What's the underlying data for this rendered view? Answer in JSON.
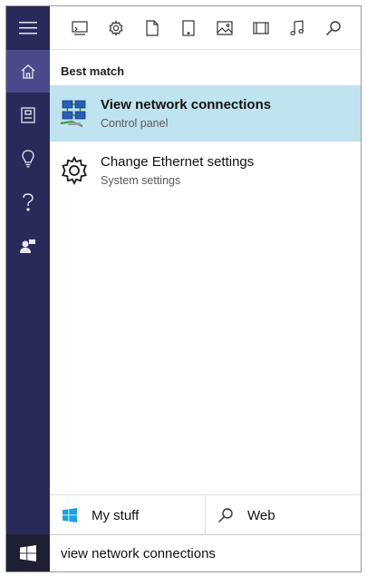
{
  "rail": {
    "items": [
      {
        "name": "hamburger-menu-icon",
        "active": false
      },
      {
        "name": "home-icon",
        "active": true
      },
      {
        "name": "notebook-icon",
        "active": false
      },
      {
        "name": "lightbulb-icon",
        "active": false
      },
      {
        "name": "help-icon",
        "active": false
      },
      {
        "name": "feedback-icon",
        "active": false
      }
    ]
  },
  "toolbar": {
    "filters": [
      "apps-icon",
      "settings-icon",
      "documents-icon",
      "tablet-icon",
      "photos-icon",
      "videos-icon",
      "music-icon",
      "search-icon"
    ]
  },
  "results": {
    "section_title": "Best match",
    "items": [
      {
        "title": "View network connections",
        "subtitle": "Control panel",
        "icon": "network-connections-icon",
        "selected": true
      },
      {
        "title": "Change Ethernet settings",
        "subtitle": "System settings",
        "icon": "gear-icon",
        "selected": false
      }
    ]
  },
  "scope": {
    "my_stuff_label": "My stuff",
    "web_label": "Web"
  },
  "search": {
    "query": "view network connections"
  },
  "colors": {
    "rail": "#2a2a5a",
    "rail_active": "#4a4a8a",
    "selected_result": "#bfe3ef",
    "windows_blue": "#1aa3e0"
  }
}
